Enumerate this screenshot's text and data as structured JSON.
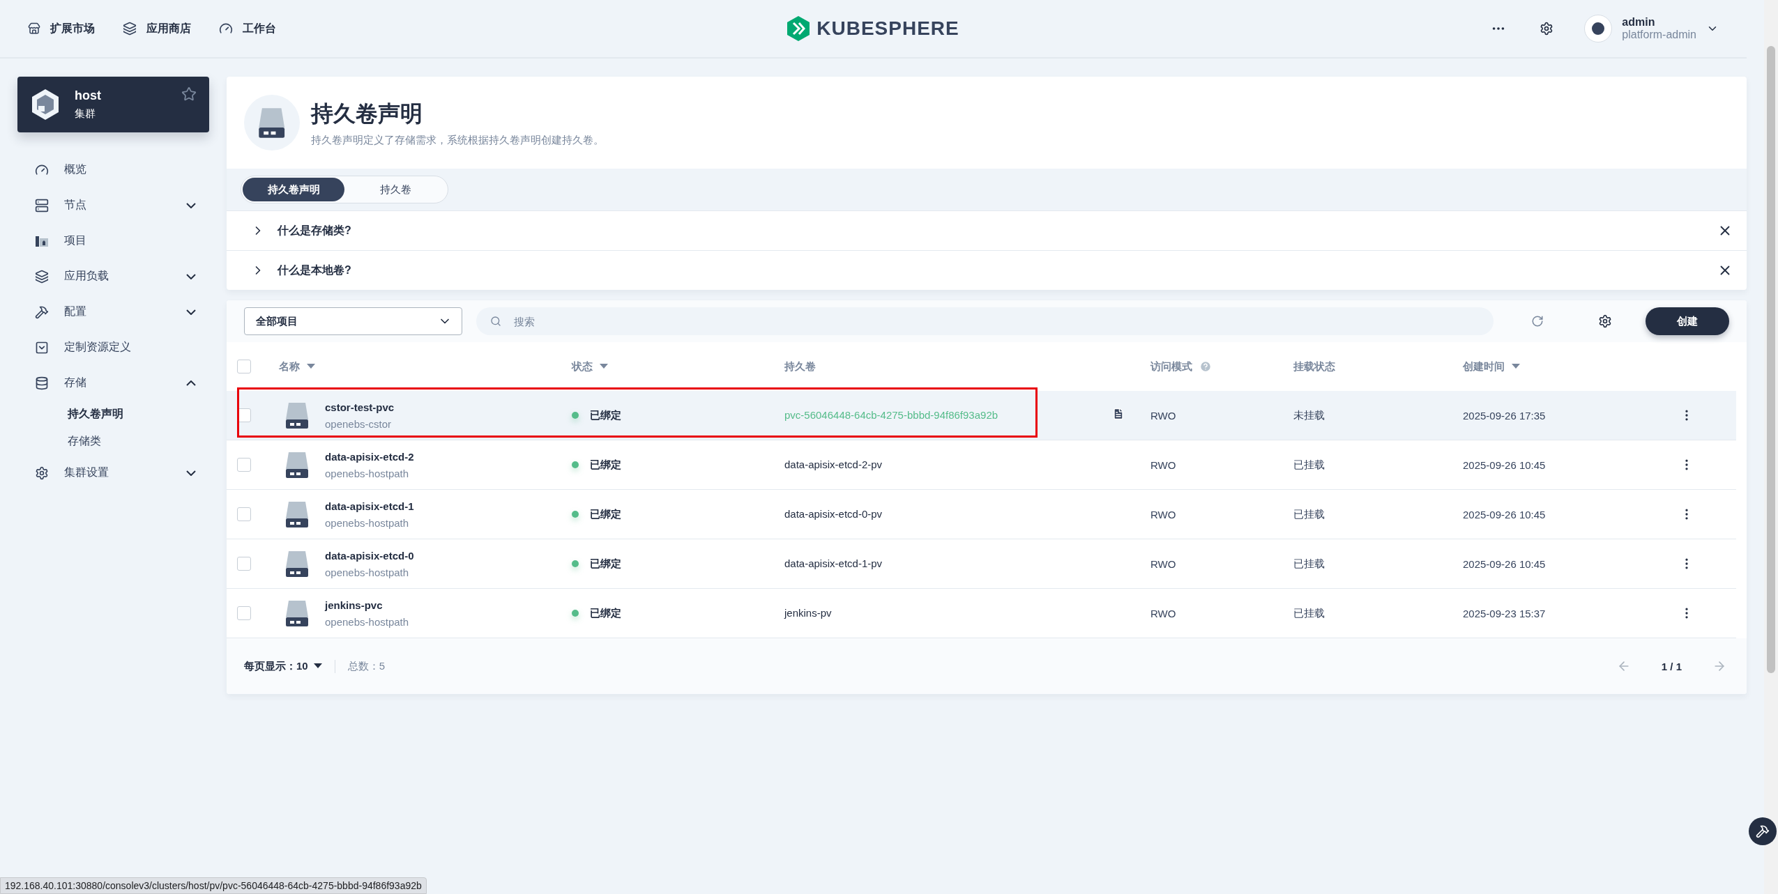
{
  "topbar": {
    "nav": [
      {
        "label": "扩展市场"
      },
      {
        "label": "应用商店"
      },
      {
        "label": "工作台"
      }
    ],
    "logo": "KUBESPHERE",
    "user": {
      "name": "admin",
      "role": "platform-admin"
    }
  },
  "cluster": {
    "name": "host",
    "type": "集群",
    "starred": false
  },
  "sidebar": {
    "items": [
      {
        "label": "概览"
      },
      {
        "label": "节点",
        "expanded": false
      },
      {
        "label": "项目"
      },
      {
        "label": "应用负载",
        "expanded": false
      },
      {
        "label": "配置",
        "expanded": false
      },
      {
        "label": "定制资源定义"
      },
      {
        "label": "存储",
        "expanded": true,
        "children": [
          {
            "label": "持久卷声明",
            "selected": true
          },
          {
            "label": "存储类",
            "selected": false
          }
        ]
      },
      {
        "label": "集群设置",
        "expanded": false
      }
    ]
  },
  "header": {
    "title": "持久卷声明",
    "description": "持久卷声明定义了存储需求，系统根据持久卷声明创建持久卷。"
  },
  "tabs": [
    {
      "label": "持久卷声明",
      "selected": true
    },
    {
      "label": "持久卷",
      "selected": false
    }
  ],
  "faq": [
    {
      "question": "什么是存储类?",
      "expanded": false
    },
    {
      "question": "什么是本地卷?",
      "expanded": false
    }
  ],
  "toolbar": {
    "project_select": "全部项目",
    "search": {
      "placeholder": "搜索"
    },
    "create_button": "创建"
  },
  "table": {
    "all_checked": false,
    "columns": [
      {
        "label": "名称",
        "sortable": true,
        "help": false
      },
      {
        "label": "状态",
        "sortable": true,
        "help": false
      },
      {
        "label": "持久卷",
        "sortable": false,
        "help": false
      },
      {
        "label": "访问模式",
        "sortable": false,
        "help": true
      },
      {
        "label": "挂载状态",
        "sortable": false,
        "help": false
      },
      {
        "label": "创建时间",
        "sortable": true,
        "help": false
      }
    ],
    "rows": [
      {
        "name": "cstor-test-pvc",
        "storage_class": "openebs-cstor",
        "status": "已绑定",
        "volume": "pvc-56046448-64cb-4275-bbbd-94f86f93a92b",
        "access_mode": "RWO",
        "mount_status": "未挂载",
        "created": "2025-09-26 17:35",
        "checked": false,
        "hovered": true,
        "highlighted": true
      },
      {
        "name": "data-apisix-etcd-2",
        "storage_class": "openebs-hostpath",
        "status": "已绑定",
        "volume": "data-apisix-etcd-2-pv",
        "access_mode": "RWO",
        "mount_status": "已挂载",
        "created": "2025-09-26 10:45",
        "checked": false,
        "hovered": false,
        "highlighted": false
      },
      {
        "name": "data-apisix-etcd-1",
        "storage_class": "openebs-hostpath",
        "status": "已绑定",
        "volume": "data-apisix-etcd-0-pv",
        "access_mode": "RWO",
        "mount_status": "已挂载",
        "created": "2025-09-26 10:45",
        "checked": false,
        "hovered": false,
        "highlighted": false
      },
      {
        "name": "data-apisix-etcd-0",
        "storage_class": "openebs-hostpath",
        "status": "已绑定",
        "volume": "data-apisix-etcd-1-pv",
        "access_mode": "RWO",
        "mount_status": "已挂载",
        "created": "2025-09-26 10:45",
        "checked": false,
        "hovered": false,
        "highlighted": false
      },
      {
        "name": "jenkins-pvc",
        "storage_class": "openebs-hostpath",
        "status": "已绑定",
        "volume": "jenkins-pv",
        "access_mode": "RWO",
        "mount_status": "已挂载",
        "created": "2025-09-23 15:37",
        "checked": false,
        "hovered": false,
        "highlighted": false
      }
    ]
  },
  "pagination": {
    "per_page_label": "每页显示：",
    "per_page": "10",
    "total": "总数：5",
    "page": "1 / 1"
  },
  "status_bar": {
    "url": "192.168.40.101:30880/consolev3/clusters/host/pv/pvc-56046448-64cb-4275-bbbd-94f86f93a92b"
  }
}
